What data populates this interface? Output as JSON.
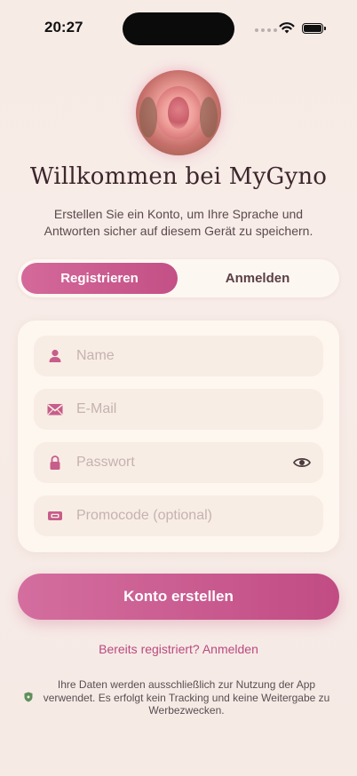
{
  "status_bar": {
    "time": "20:27"
  },
  "header": {
    "title": "Willkommen bei MyGyno",
    "subtitle": "Erstellen Sie ein Konto, um Ihre Sprache und Antworten sicher auf diesem Gerät zu speichern."
  },
  "tabs": {
    "register_label": "Registrieren",
    "login_label": "Anmelden",
    "active": "Registrieren"
  },
  "form": {
    "name_placeholder": "Name",
    "email_placeholder": "E-Mail",
    "password_placeholder": "Passwort",
    "promo_placeholder": "Promocode (optional)",
    "icons": [
      "person-icon",
      "envelope-icon",
      "lock-icon",
      "eye-icon",
      "ticket-icon"
    ]
  },
  "actions": {
    "create_account_label": "Konto erstellen",
    "already_registered_link": "Bereits registriert? Anmelden"
  },
  "privacy_note": "Ihre Daten werden ausschließlich zur Nutzung der App verwendet. Es erfolgt kein Tracking und keine Weitergabe zu Werbezwecken.",
  "colors": {
    "accent": "#c9568c",
    "accent_light": "#d46e9f",
    "background": "#f7ebe6",
    "card": "#fdf7f0",
    "field": "#f8ede4",
    "icon": "#c75d8b",
    "shield": "#5f8f5a"
  }
}
